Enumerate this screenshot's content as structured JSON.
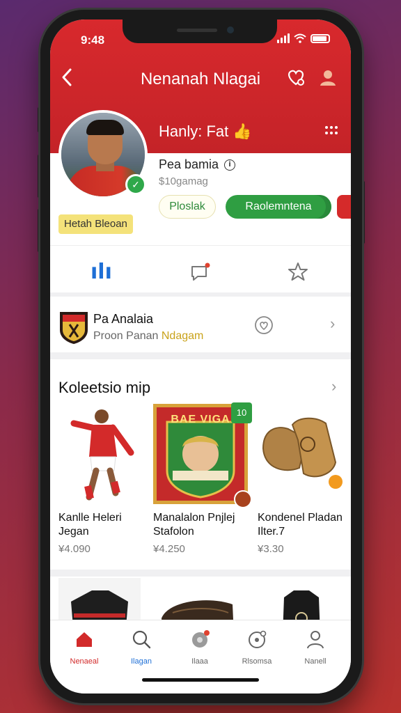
{
  "status_bar": {
    "time": "9:48"
  },
  "nav": {
    "title": "Nenanah Nlagai"
  },
  "profile": {
    "name": "Hanly: Fat",
    "line1": "Pea bamia",
    "line2": "$10gamag",
    "follow_label": "Ploslak",
    "primary_label": "Raolemntena",
    "tag": "Hetah Bleoan"
  },
  "club": {
    "name": "Pa Analaia",
    "sub_prefix": "Proon Panan ",
    "sub_highlight": "Ndagam"
  },
  "collection": {
    "title": "Koleetsio mip",
    "items": [
      {
        "title": "Kanlle Heleri Jegan",
        "price": "¥4.090"
      },
      {
        "title": "Manalalon Pnjlej Stafolon",
        "price": "¥4.250"
      },
      {
        "title": "Kondenel Pladan Ilter.7",
        "price": "¥3.30"
      }
    ],
    "card_badge": "10",
    "card_banner": "BAE VIGA"
  },
  "tabbar": {
    "items": [
      {
        "label": "Nenaeal",
        "active": true
      },
      {
        "label": "Ilagan",
        "active": false
      },
      {
        "label": "Ilaaa",
        "active": false
      },
      {
        "label": "Rlsomsa",
        "active": false
      },
      {
        "label": "Nanell",
        "active": false
      }
    ]
  },
  "colors": {
    "brand_red": "#d8292d",
    "green": "#2f9e42",
    "blue": "#1e6fd6",
    "gold": "#c9a21a"
  }
}
